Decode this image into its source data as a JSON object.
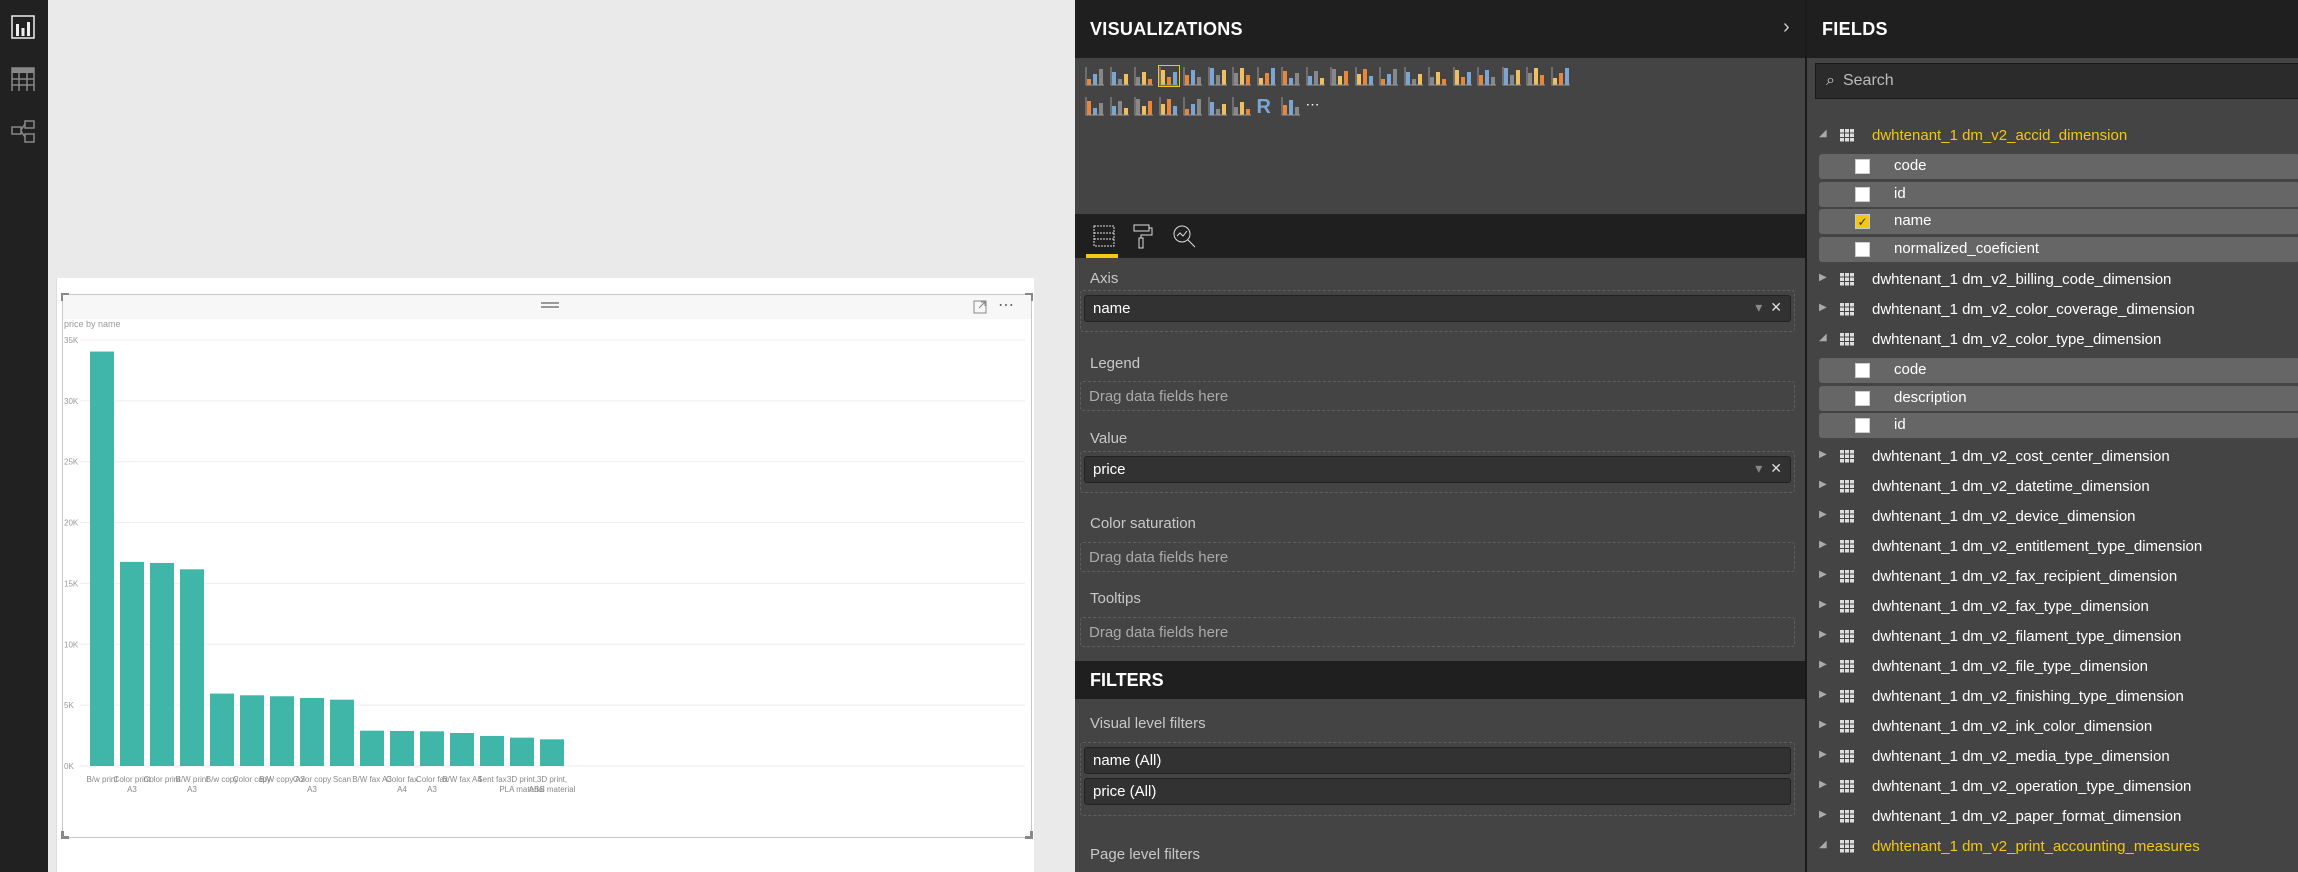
{
  "nav": {
    "items": [
      {
        "name": "report-view-icon"
      },
      {
        "name": "data-view-icon"
      },
      {
        "name": "relationships-view-icon"
      }
    ]
  },
  "visual": {
    "more_label": "⋯"
  },
  "chart_data": {
    "type": "bar",
    "title": "price by name",
    "xlabel": "",
    "ylabel": "",
    "ylim": [
      0,
      35000
    ],
    "yticks": [
      "0K",
      "5K",
      "10K",
      "15K",
      "20K",
      "25K",
      "30K",
      "35K"
    ],
    "categories": [
      "B/w print",
      "Color print A3",
      "Color print",
      "B/W print A3",
      "B/w copy",
      "Color copy",
      "B/W copy A3",
      "Color copy A3",
      "Scan",
      "B/W fax A3",
      "Color fax A4",
      "Color fax A3",
      "B/W fax A4",
      "Sent fax",
      "3D print, PLA material",
      "3D print, ABS material"
    ],
    "values": [
      34050,
      16770,
      16680,
      16160,
      5950,
      5810,
      5730,
      5590,
      5450,
      2900,
      2880,
      2850,
      2710,
      2470,
      2330,
      2190
    ],
    "bar_color": "#3fb6a8",
    "grid": true
  },
  "visualizations": {
    "title": "VISUALIZATIONS",
    "collapse_icon": "chevron-right-icon",
    "icons": [
      "stacked-bar-icon",
      "stacked-column-icon",
      "clustered-bar-icon",
      "clustered-column-icon",
      "100-stacked-bar-icon",
      "100-stacked-column-icon",
      "line-chart-icon",
      "area-chart-icon",
      "stacked-area-icon",
      "line-stacked-column-icon",
      "line-clustered-column-icon",
      "ribbon-chart-icon",
      "waterfall-icon",
      "scatter-icon",
      "pie-icon",
      "donut-icon",
      "treemap-icon",
      "map-icon",
      "filled-map-icon",
      "funnel-icon",
      "gauge-icon",
      "card-icon",
      "multi-row-card-icon",
      "kpi-icon",
      "slicer-icon",
      "table-icon",
      "matrix-icon",
      "r-visual-icon",
      "globe-icon",
      "more-visuals-icon"
    ],
    "selected_index": 3,
    "tabs": [
      "fields-tab-icon",
      "format-tab-icon",
      "analytics-tab-icon"
    ],
    "wells": [
      {
        "label": "Axis",
        "value": "name"
      },
      {
        "label": "Legend",
        "placeholder": "Drag data fields here"
      },
      {
        "label": "Value",
        "value": "price"
      },
      {
        "label": "Color saturation",
        "placeholder": "Drag data fields here"
      },
      {
        "label": "Tooltips",
        "placeholder": "Drag data fields here"
      }
    ],
    "remove": "✕",
    "dropdown": "▾"
  },
  "filters": {
    "title": "FILTERS",
    "visual_level_label": "Visual level filters",
    "visual_filters": [
      "name  (All)",
      "price  (All)"
    ],
    "page_level_label": "Page level filters"
  },
  "fields": {
    "title": "FIELDS",
    "search_placeholder": "Search",
    "tables": [
      {
        "name": "dwhtenant_1 dm_v2_accid_dimension",
        "expanded": true,
        "active": true,
        "fields": [
          {
            "name": "code",
            "checked": false
          },
          {
            "name": "id",
            "checked": false
          },
          {
            "name": "name",
            "checked": true
          },
          {
            "name": "normalized_coeficient",
            "checked": false
          }
        ]
      },
      {
        "name": "dwhtenant_1 dm_v2_billing_code_dimension",
        "expanded": false
      },
      {
        "name": "dwhtenant_1 dm_v2_color_coverage_dimension",
        "expanded": false
      },
      {
        "name": "dwhtenant_1 dm_v2_color_type_dimension",
        "expanded": true,
        "fields": [
          {
            "name": "code",
            "checked": false
          },
          {
            "name": "description",
            "checked": false
          },
          {
            "name": "id",
            "checked": false
          }
        ]
      },
      {
        "name": "dwhtenant_1 dm_v2_cost_center_dimension",
        "expanded": false
      },
      {
        "name": "dwhtenant_1 dm_v2_datetime_dimension",
        "expanded": false
      },
      {
        "name": "dwhtenant_1 dm_v2_device_dimension",
        "expanded": false
      },
      {
        "name": "dwhtenant_1 dm_v2_entitlement_type_dimension",
        "expanded": false
      },
      {
        "name": "dwhtenant_1 dm_v2_fax_recipient_dimension",
        "expanded": false
      },
      {
        "name": "dwhtenant_1 dm_v2_fax_type_dimension",
        "expanded": false
      },
      {
        "name": "dwhtenant_1 dm_v2_filament_type_dimension",
        "expanded": false
      },
      {
        "name": "dwhtenant_1 dm_v2_file_type_dimension",
        "expanded": false
      },
      {
        "name": "dwhtenant_1 dm_v2_finishing_type_dimension",
        "expanded": false
      },
      {
        "name": "dwhtenant_1 dm_v2_ink_color_dimension",
        "expanded": false
      },
      {
        "name": "dwhtenant_1 dm_v2_media_type_dimension",
        "expanded": false
      },
      {
        "name": "dwhtenant_1 dm_v2_operation_type_dimension",
        "expanded": false
      },
      {
        "name": "dwhtenant_1 dm_v2_paper_format_dimension",
        "expanded": false
      },
      {
        "name": "dwhtenant_1 dm_v2_print_accounting_measures",
        "expanded": true,
        "active": true,
        "fields": []
      }
    ]
  },
  "colors": {
    "accent": "#f2c811",
    "bar": "#3fb6a8"
  }
}
